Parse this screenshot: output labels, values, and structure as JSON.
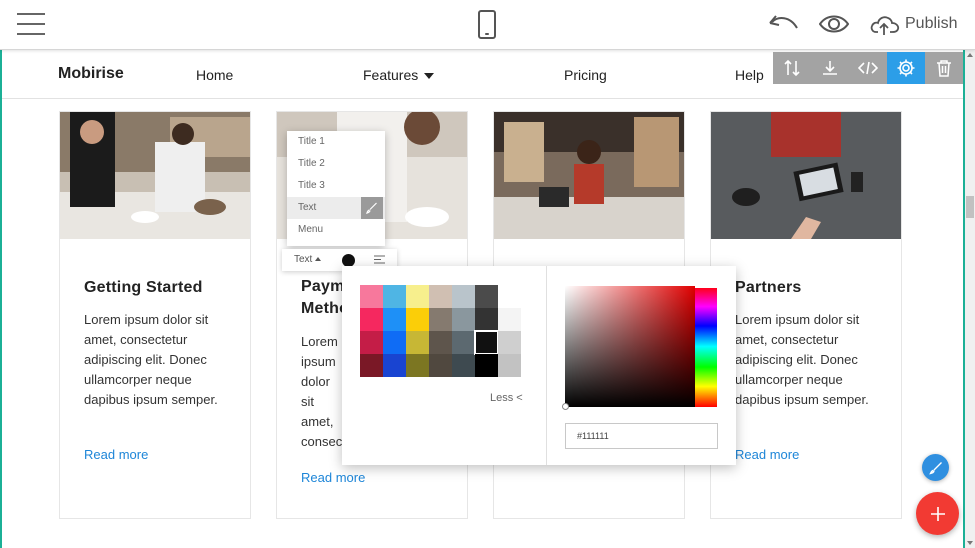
{
  "editor": {
    "publish_label": "Publish",
    "icons": [
      "menu-icon",
      "mobile-preview-icon",
      "undo-icon",
      "preview-eye-icon",
      "cloud-upload-icon"
    ]
  },
  "site": {
    "brand": "Mobirise",
    "nav": [
      {
        "label": "Home"
      },
      {
        "label": "Features",
        "has_dropdown": true
      },
      {
        "label": "Pricing"
      },
      {
        "label": "Help"
      }
    ],
    "block_tools": [
      "sort-icon",
      "download-icon",
      "code-icon",
      "gear-icon",
      "trash-icon"
    ]
  },
  "cards": [
    {
      "title": "Getting Started",
      "text": "Lorem ipsum dolor sit amet, consectetur adipiscing elit. Donec ullamcorper neque dapibus ipsum semper.",
      "link": "Read more"
    },
    {
      "title": "Payment Methods",
      "text": "Lorem ipsum dolor sit amet, consectetur adipiscing elit. Donec ullamcorper neque dapibus ipsum semper.",
      "link": "Read more"
    },
    {
      "title": "",
      "text": "",
      "link": ""
    },
    {
      "title": "Partners",
      "text": "Lorem ipsum dolor sit amet, consectetur adipiscing elit. Donec ullamcorper neque dapibus ipsum semper.",
      "link": "Read more"
    }
  ],
  "style_menu": {
    "items": [
      "Title 1",
      "Title 2",
      "Title 3",
      "Text",
      "Menu"
    ],
    "selected": "Text"
  },
  "format_bar": {
    "style_label": "Text",
    "current_color": "#111111"
  },
  "color_picker": {
    "swatch_columns": [
      [
        "#f7789c",
        "#f5285f",
        "#c41d47",
        "#7a1826"
      ],
      [
        "#4fb5e4",
        "#1e90f7",
        "#0f6cf5",
        "#1944d1"
      ],
      [
        "#f7ef8d",
        "#fbce08",
        "#c7b735",
        "#7c7622"
      ],
      [
        "#d0bfb2",
        "#857a6f",
        "#5e554c",
        "#50483f"
      ],
      [
        "#b9c4cb",
        "#8a979e",
        "#5c6970",
        "#3e4a50"
      ],
      [
        "#4b4b4b",
        "#333333",
        "#111111",
        "#000000"
      ],
      [
        "#ffffff",
        "#f4f4f4",
        "#cfcfcf",
        "#c2c2c2"
      ]
    ],
    "less_label": "Less <",
    "hex_value": "#111111",
    "hue_color": "#e00000"
  },
  "colors": {
    "accent_teal": "#1bb096",
    "link_blue": "#1e86d8",
    "active_tool": "#2c9ee8",
    "fab_add": "#f23a33",
    "fab_brush": "#2f8fe0"
  }
}
